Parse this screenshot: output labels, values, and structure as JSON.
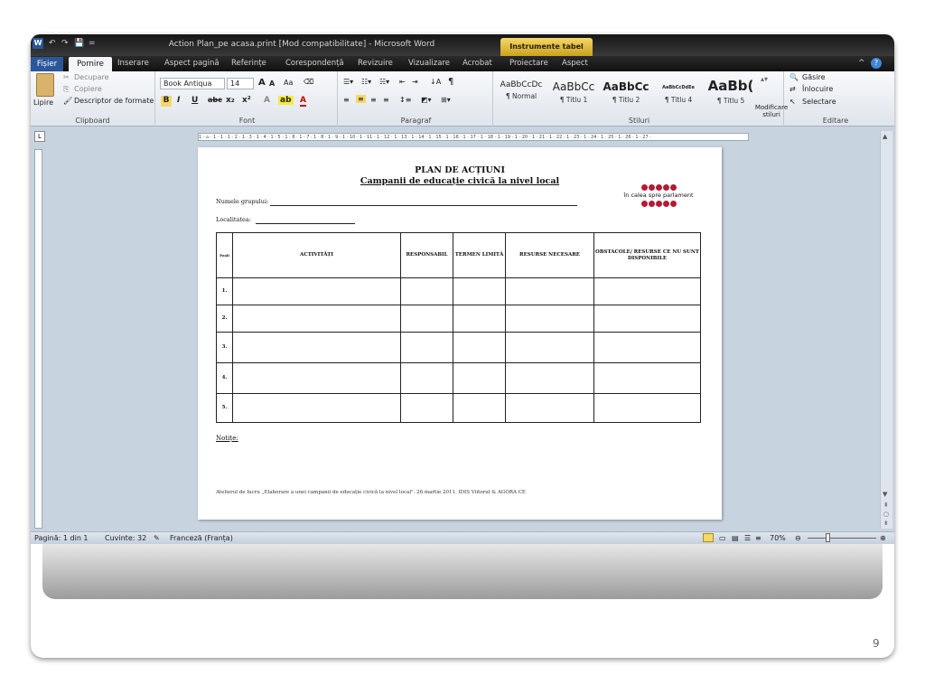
{
  "window": {
    "title": "Action Plan_pe acasa.print [Mod compatibilitate] - Microsoft Word",
    "contextual_tab": "Instrumente tabel",
    "quick_access": [
      "↶",
      "↷",
      "💾",
      "="
    ]
  },
  "tabs": [
    "Fișier",
    "Pornire",
    "Inserare",
    "Aspect pagină",
    "Referințe",
    "Corespondență",
    "Revizuire",
    "Vizualizare",
    "Acrobat",
    "Proiectare",
    "Aspect"
  ],
  "ribbon": {
    "clipboard": {
      "paste": "Lipire",
      "cut": "Decupare",
      "copy": "Copiere",
      "format_painter": "Descriptor de formate",
      "label": "Clipboard"
    },
    "font": {
      "name": "Book Antiqua",
      "size": "14",
      "grow": "A",
      "shrink": "A",
      "case": "Aa",
      "bold": "B",
      "italic": "I",
      "underline": "U",
      "strike": "abc",
      "sub": "x₂",
      "sup": "x²",
      "label": "Font"
    },
    "paragraph": {
      "label": "Paragraf"
    },
    "styles": {
      "label": "Stiluri",
      "items": [
        {
          "preview": "AaBbCcDc",
          "name": "¶ Normal"
        },
        {
          "preview": "AaBbCc",
          "name": "¶ Titlu 1"
        },
        {
          "preview": "AaBbCc",
          "name": "¶ Titlu 2"
        },
        {
          "preview": "AaBbCcDdEe",
          "name": "¶ Titlu 4"
        },
        {
          "preview": "AaBb(",
          "name": "¶ Titlu 5"
        }
      ],
      "change_styles": "Modificare stiluri"
    },
    "editing": {
      "find": "Găsire",
      "replace": "Înlocuire",
      "select": "Selectare",
      "label": "Editare"
    }
  },
  "ruler": "1 · ⌂ · 1 · 1 · 1 · 2 · 1 · 3 · 1 · 4 · 1 · 5 · 1 · 6 · 1 · 7 · 1 · 8 · 1 · 9 · 1 · 10 · 1 · 11 · 1 · 12 · 1 · 13 · 1 · 14 · 1 · 15 · 1 · 16 · 1 · 17 · 1 · 18 · 1 · 19 · 1 · 20 · 1 · 21 · 1 · 22 · 1 · 23 · 1 · 24 · 1 · 25 · 1 · 26 · 1 · 27 ·",
  "document": {
    "title": "PLAN DE ACȚIUNI",
    "subtitle": "Campanii de educație civică la nivel local",
    "group_label": "Numele grupului:",
    "locality_label": "Localitatea:",
    "logo_text": "în calea spre parlament",
    "table": {
      "headers": [
        "Pașii",
        "ACTIVITĂȚI",
        "RESPONSABIL",
        "TERMEN LIMITĂ",
        "RESURSE NECESARE",
        "OBSTACOLE/ RESURSE CE NU SUNT DISPONIBILE"
      ],
      "rows": [
        "1.",
        "2.",
        "3.",
        "4.",
        "5."
      ]
    },
    "notes_label": "Notițe:",
    "footer": "Atelierul de lucru „Elaborare a unei campanii de educație civică la nivel local\". 26 martie 2011. IDIS Viitorul & AGORA CE"
  },
  "status": {
    "page": "Pagină: 1 din 1",
    "words": "Cuvinte: 32",
    "language": "Franceză (Franța)",
    "zoom": "70%"
  },
  "slide_number": "9"
}
